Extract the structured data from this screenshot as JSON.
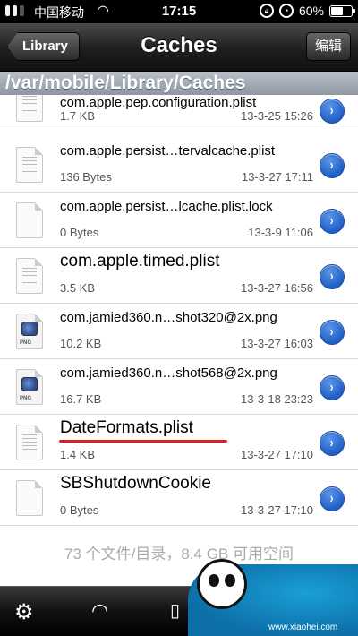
{
  "status_bar": {
    "carrier": "中国移动",
    "time": "17:15",
    "battery": "60%",
    "battery_level": 0.6
  },
  "nav": {
    "back_label": "Library",
    "title": "Caches",
    "edit_label": "编辑"
  },
  "path": "/var/mobile/Library/Caches",
  "files": [
    {
      "name": "com.apple.pep.configuration.plist",
      "size": "1.7 KB",
      "date": "13-3-25 15:26",
      "icon": "document-icon"
    },
    {
      "name": "com.apple.persist…tervalcache.plist",
      "size": "136 Bytes",
      "date": "13-3-27 17:11",
      "icon": "document-icon"
    },
    {
      "name": "com.apple.persist…lcache.plist.lock",
      "size": "0 Bytes",
      "date": "13-3-9 11:06",
      "icon": "blank-file-icon"
    },
    {
      "name": "com.apple.timed.plist",
      "size": "3.5 KB",
      "date": "13-3-27 16:56",
      "icon": "document-icon"
    },
    {
      "name": "com.jamied360.n…shot320@2x.png",
      "size": "10.2 KB",
      "date": "13-3-27 16:03",
      "icon": "png-icon"
    },
    {
      "name": "com.jamied360.n…shot568@2x.png",
      "size": "16.7 KB",
      "date": "13-3-18 23:23",
      "icon": "png-icon"
    },
    {
      "name": "DateFormats.plist",
      "size": "1.4 KB",
      "date": "13-3-27 17:10",
      "icon": "document-icon"
    },
    {
      "name": "SBShutdownCookie",
      "size": "0 Bytes",
      "date": "13-3-27 17:10",
      "icon": "blank-file-icon"
    }
  ],
  "png_label": "PNG",
  "summary": "73 个文件/目录，8.4 GB 可用空间",
  "toolbar": {
    "icons": [
      "gear-icon",
      "wifi-icon",
      "book-icon"
    ]
  },
  "watermark": {
    "url": "www.xiaohei.com"
  }
}
